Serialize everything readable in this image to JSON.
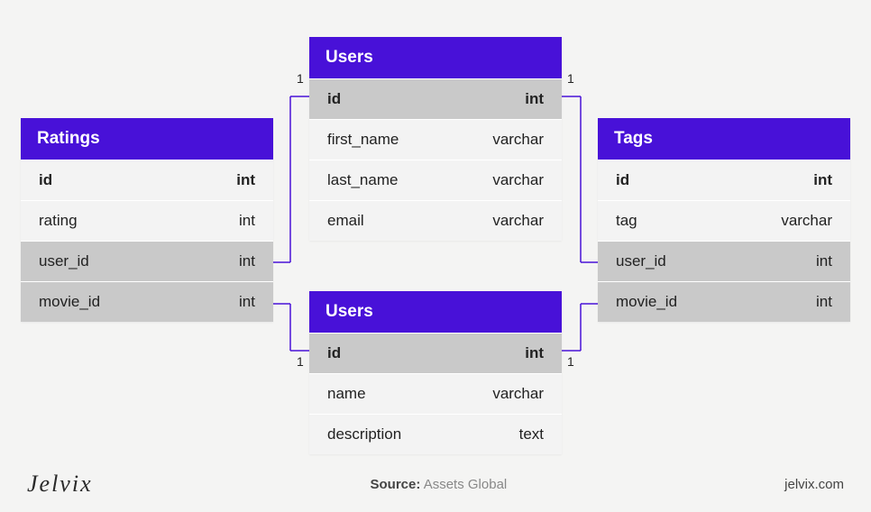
{
  "brand": "Jelvix",
  "site": "jelvix.com",
  "source_label": "Source:",
  "source_value": "Assets Global",
  "tables": {
    "ratings": {
      "title": "Ratings",
      "rows": [
        {
          "name": "id",
          "type": "int",
          "bold": true,
          "alt": false
        },
        {
          "name": "rating",
          "type": "int",
          "bold": false,
          "alt": false
        },
        {
          "name": "user_id",
          "type": "int",
          "bold": false,
          "alt": true
        },
        {
          "name": "movie_id",
          "type": "int",
          "bold": false,
          "alt": true
        }
      ]
    },
    "users_top": {
      "title": "Users",
      "rows": [
        {
          "name": "id",
          "type": "int",
          "bold": true,
          "alt": true
        },
        {
          "name": "first_name",
          "type": "varchar",
          "bold": false,
          "alt": false
        },
        {
          "name": "last_name",
          "type": "varchar",
          "bold": false,
          "alt": false
        },
        {
          "name": "email",
          "type": "varchar",
          "bold": false,
          "alt": false
        }
      ]
    },
    "users_bottom": {
      "title": "Users",
      "rows": [
        {
          "name": "id",
          "type": "int",
          "bold": true,
          "alt": true
        },
        {
          "name": "name",
          "type": "varchar",
          "bold": false,
          "alt": false
        },
        {
          "name": "description",
          "type": "text",
          "bold": false,
          "alt": false
        }
      ]
    },
    "tags": {
      "title": "Tags",
      "rows": [
        {
          "name": "id",
          "type": "int",
          "bold": true,
          "alt": false
        },
        {
          "name": "tag",
          "type": "varchar",
          "bold": false,
          "alt": false
        },
        {
          "name": "user_id",
          "type": "int",
          "bold": false,
          "alt": true
        },
        {
          "name": "movie_id",
          "type": "int",
          "bold": false,
          "alt": true
        }
      ]
    }
  },
  "cardinalities": {
    "users_top_left": "1",
    "users_top_right": "1",
    "users_bottom_left": "1",
    "users_bottom_right": "1"
  }
}
